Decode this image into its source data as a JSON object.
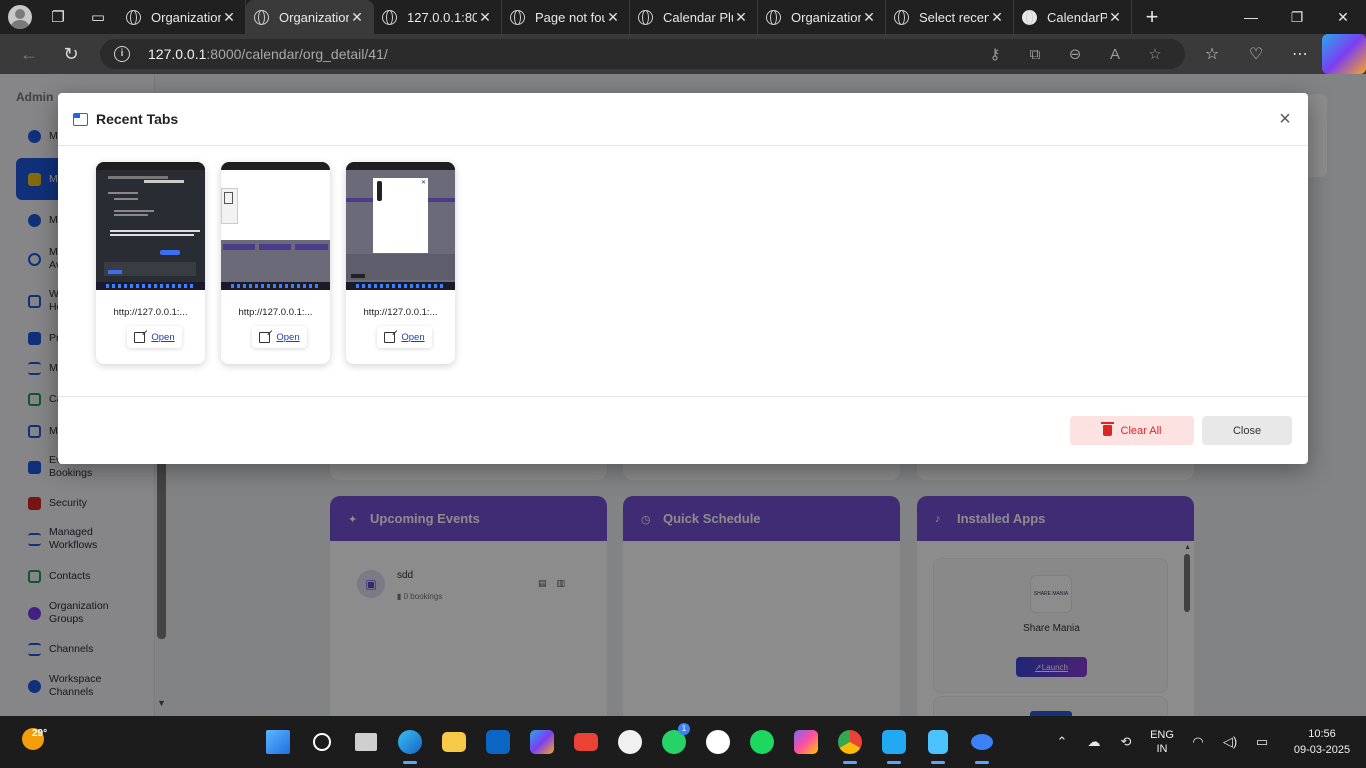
{
  "browser": {
    "tabs": [
      {
        "title": "Organization",
        "active": false
      },
      {
        "title": "Organization",
        "active": true
      },
      {
        "title": "127.0.0.1:800",
        "active": false
      },
      {
        "title": "Page not fou",
        "active": false
      },
      {
        "title": "Calendar Plu",
        "active": false
      },
      {
        "title": "Organization",
        "active": false
      },
      {
        "title": "Select recen",
        "active": false
      },
      {
        "title": "CalendarPlu",
        "active": false
      }
    ],
    "url_host": "127.0.0.1",
    "url_path": ":8000/calendar/org_detail/41/"
  },
  "sidebar": {
    "brand": "Admin",
    "items": [
      {
        "label": "Me",
        "color": "#1e5adc"
      },
      {
        "label": "M",
        "color": "#f2c31b"
      },
      {
        "label": "Ma",
        "color": "#1e5adc"
      },
      {
        "label": "M\nAv",
        "color": "#1e5adc"
      },
      {
        "label": "W\nHo",
        "color": "#1e5adc"
      },
      {
        "label": "Pr",
        "color": "#1e5adc"
      },
      {
        "label": "M",
        "color": "#1e5adc"
      },
      {
        "label": "Ca",
        "color": "#16a34a"
      },
      {
        "label": "M",
        "color": "#1e5adc"
      },
      {
        "label": "Ev\nBookings",
        "color": "#1e5adc"
      },
      {
        "label": "Security",
        "color": "#dc2626"
      },
      {
        "label": "Managed\nWorkflows",
        "color": "#1e5adc"
      },
      {
        "label": "Contacts",
        "color": "#16a34a"
      },
      {
        "label": "Organization\nGroups",
        "color": "#7c3aed"
      },
      {
        "label": "Channels",
        "color": "#1e5adc"
      },
      {
        "label": "Workspace\nChannels",
        "color": "#1e5adc"
      }
    ]
  },
  "cards": {
    "upcoming": {
      "title": "Upcoming Events",
      "event_name": "sdd",
      "event_meta": "0 bookings"
    },
    "quick": {
      "title": "Quick Schedule"
    },
    "apps": {
      "title": "Installed Apps",
      "app_name": "Share Mania",
      "app_logo_text": "SHARE MANIA",
      "launch_label": "Launch"
    }
  },
  "modal": {
    "title": "Recent Tabs",
    "close_symbol": "×",
    "tabs": [
      {
        "url": "http://127.0.0.1:...",
        "open_label": "Open",
        "thumb": "dark"
      },
      {
        "url": "http://127.0.0.1:...",
        "open_label": "Open",
        "thumb": "light"
      },
      {
        "url": "http://127.0.0.1:...",
        "open_label": "Open",
        "thumb": "grey"
      }
    ],
    "clear_label": "Clear All",
    "close_label": "Close"
  },
  "taskbar": {
    "temperature": "29°",
    "lang_top": "ENG",
    "lang_bottom": "IN",
    "time": "10:56",
    "date": "09-03-2025",
    "whatsapp_badge": "1",
    "accent": "#60a5fa"
  }
}
